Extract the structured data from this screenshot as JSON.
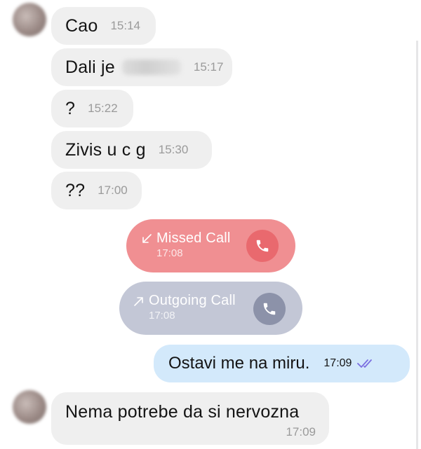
{
  "conversation": {
    "messages": [
      {
        "text": "Cao",
        "time": "15:14"
      },
      {
        "text": "Dali je",
        "time": "15:17"
      },
      {
        "text": "?",
        "time": "15:22"
      },
      {
        "text": "Zivis u c g",
        "time": "15:30"
      },
      {
        "text": "??",
        "time": "17:00"
      }
    ],
    "missed_call": {
      "label": "Missed Call",
      "time": "17:08",
      "color": "#f08f92",
      "circle_color": "#e9696e"
    },
    "outgoing_call": {
      "label": "Outgoing Call",
      "time": "17:08",
      "color": "#c3c7d6",
      "circle_color": "#8c92a9"
    },
    "sent": {
      "text": "Ostavi me na miru.",
      "time": "17:09",
      "status_icon": "double-check-icon",
      "color": "#d3e9fb",
      "check_color": "#7b6fe0"
    },
    "last": {
      "text": "Nema potrebe da si nervozna",
      "time": "17:09"
    }
  }
}
